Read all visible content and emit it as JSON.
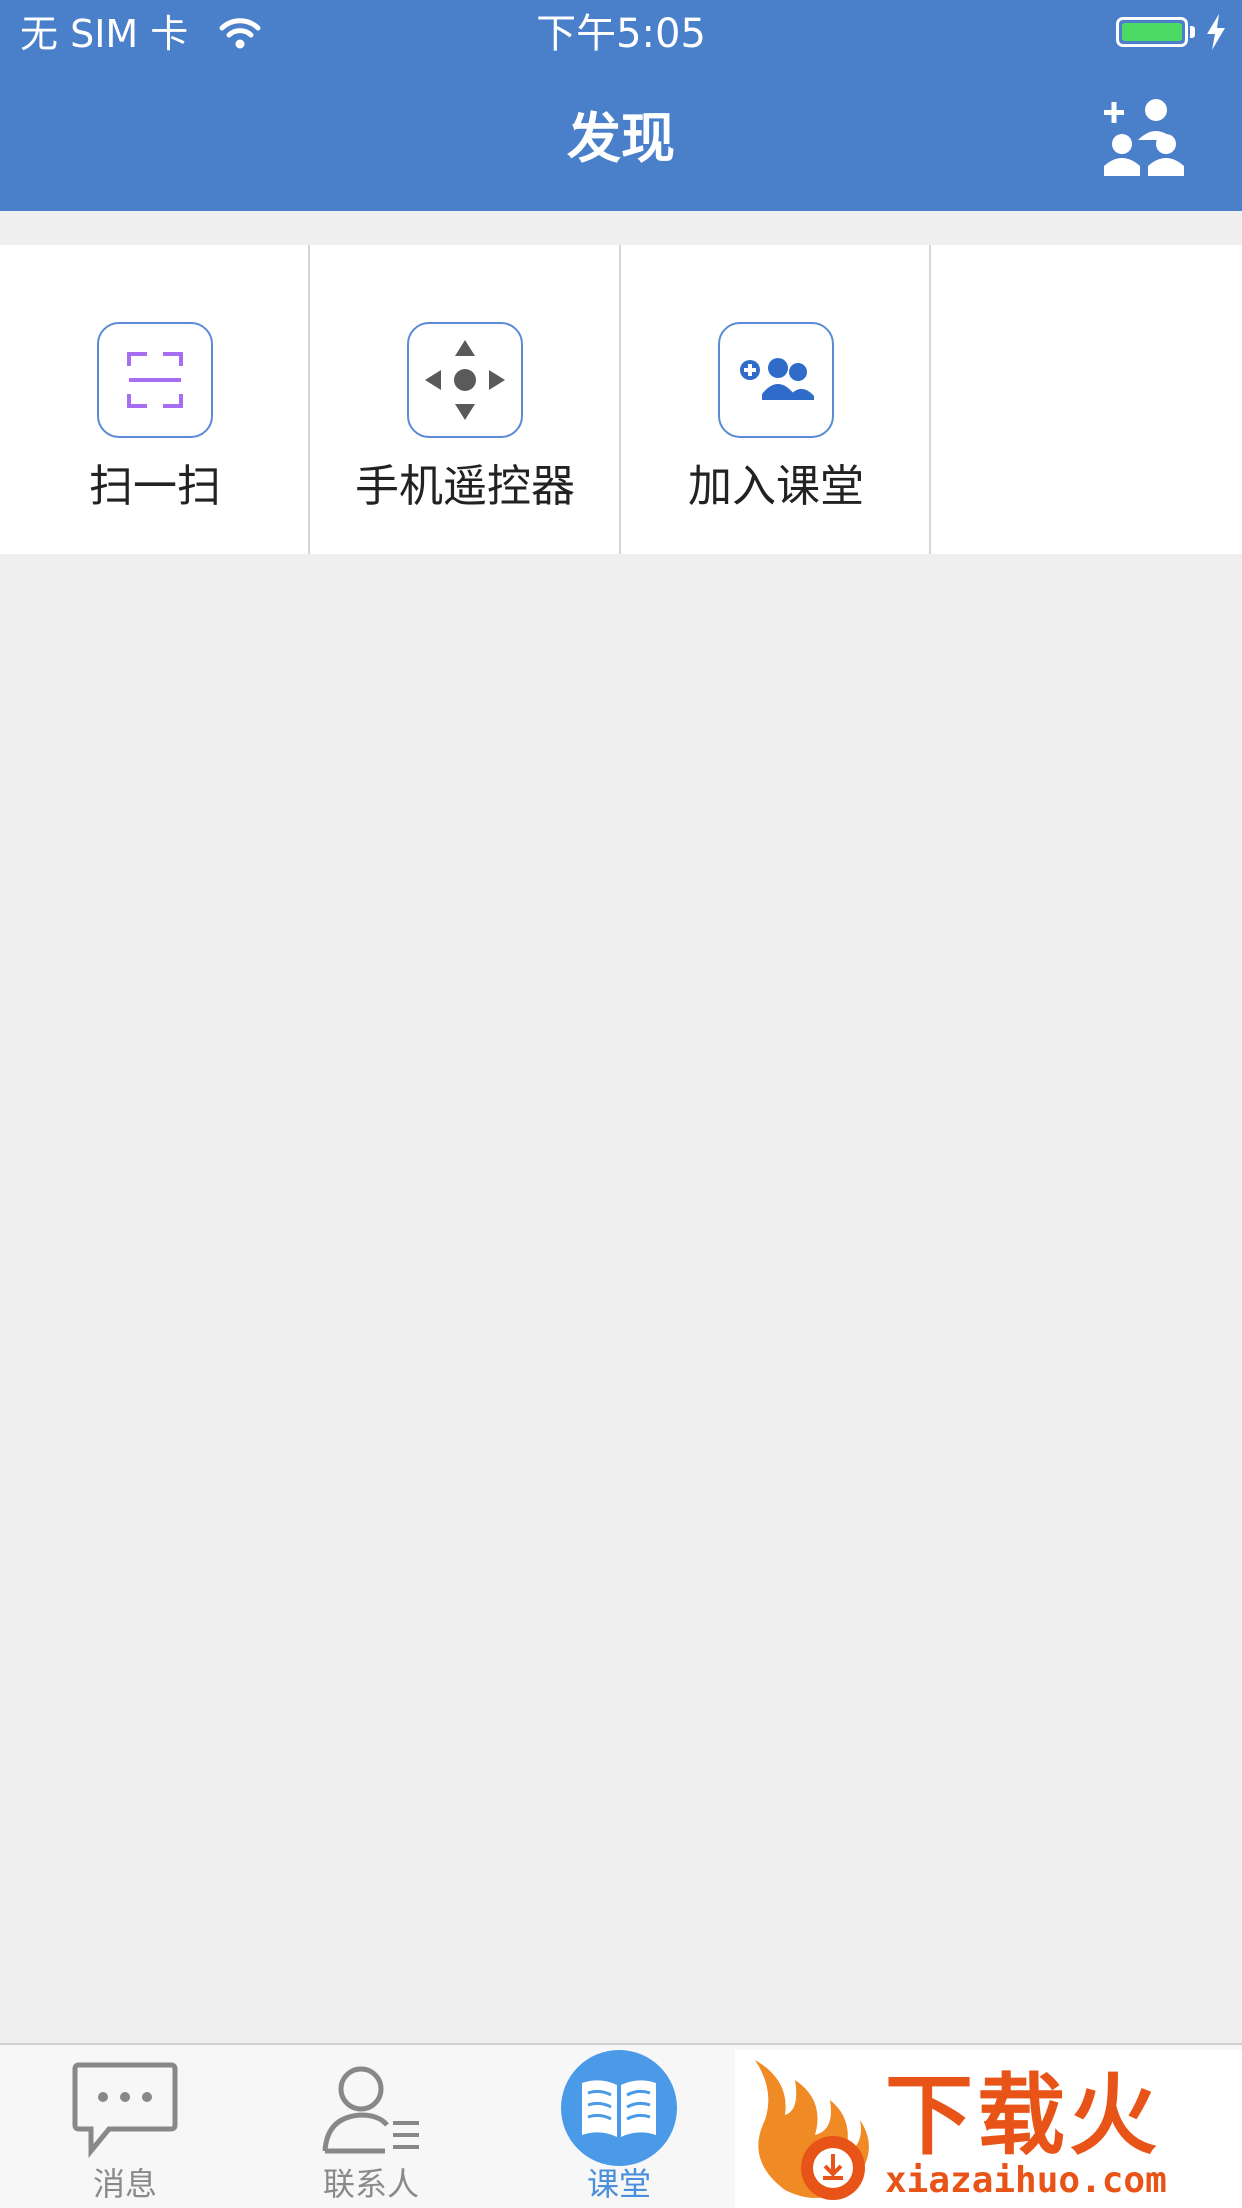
{
  "status_bar": {
    "carrier": "无 SIM 卡",
    "time": "下午5:05",
    "battery_color": "#4cd964"
  },
  "nav": {
    "title": "发现",
    "right_icon": "add-contact-icon",
    "background": "#4a7fc9"
  },
  "tools": [
    {
      "label": "扫一扫",
      "icon": "scan-icon"
    },
    {
      "label": "手机遥控器",
      "icon": "remote-control-icon"
    },
    {
      "label": "加入课堂",
      "icon": "join-class-icon"
    }
  ],
  "tabbar": {
    "tabs": [
      {
        "label": "消息",
        "icon": "chat-bubble-icon",
        "active": false
      },
      {
        "label": "联系人",
        "icon": "contacts-icon",
        "active": false
      },
      {
        "label": "课堂",
        "icon": "book-icon",
        "active": true
      }
    ],
    "active_color": "#4a8fdc"
  },
  "watermark": {
    "brand": "下载火",
    "domain": "xiazaihuo.com",
    "color": "#e85418"
  }
}
